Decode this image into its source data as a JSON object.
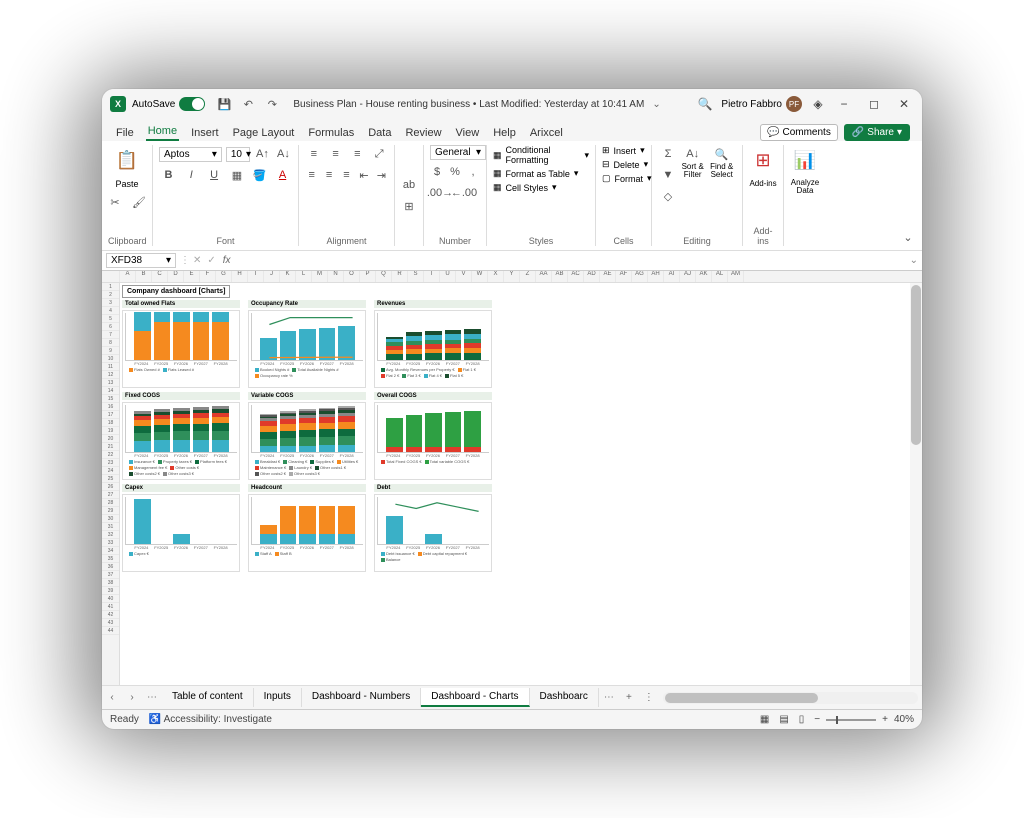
{
  "app": {
    "name": "X",
    "autosave_label": "AutoSave",
    "autosave_on": "On"
  },
  "document": {
    "title": "Business Plan - House renting business • Last Modified: Yesterday at 10:41 AM"
  },
  "user": {
    "name": "Pietro Fabbro",
    "initials": "PF"
  },
  "window_controls": {
    "minimize": "−",
    "restore": "◻",
    "close": "✕"
  },
  "title_actions": {
    "share": "Share",
    "comments": "Comments"
  },
  "menu_tabs": [
    "File",
    "Home",
    "Insert",
    "Page Layout",
    "Formulas",
    "Data",
    "Review",
    "View",
    "Help",
    "Arixcel"
  ],
  "menu_active": "Home",
  "ribbon": {
    "clipboard": {
      "label": "Clipboard",
      "paste": "Paste"
    },
    "font": {
      "label": "Font",
      "name": "Aptos",
      "size": "10"
    },
    "alignment": {
      "label": "Alignment"
    },
    "number": {
      "label": "Number",
      "format": "General"
    },
    "styles": {
      "label": "Styles",
      "cond": "Conditional Formatting",
      "table": "Format as Table",
      "cell": "Cell Styles"
    },
    "cells": {
      "label": "Cells",
      "insert": "Insert",
      "delete": "Delete",
      "format": "Format"
    },
    "editing": {
      "label": "Editing",
      "sort": "Sort & Filter",
      "find": "Find & Select"
    },
    "addins": {
      "label": "Add-ins",
      "btn": "Add-ins"
    },
    "analyze": {
      "label": "",
      "btn": "Analyze Data"
    }
  },
  "name_box": "XFD38",
  "formula": "",
  "dashboard_title": "Company dashboard [Charts]",
  "sheet_tabs": [
    "Table of content",
    "Inputs",
    "Dashboard - Numbers",
    "Dashboard - Charts",
    "Dashboarc"
  ],
  "sheet_active": "Dashboard - Charts",
  "status": {
    "ready": "Ready",
    "access": "Accessibility: Investigate",
    "zoom": "40%"
  },
  "chart_data": [
    {
      "type": "bar",
      "title": "Total owned Flats",
      "categories": [
        "FY2024",
        "FY2025",
        "FY2026",
        "FY2027",
        "FY2028"
      ],
      "series": [
        {
          "name": "Flats Owned #",
          "color": "#f58a1f",
          "values": [
            3,
            4,
            4,
            4,
            4
          ]
        },
        {
          "name": "Flats Leased #",
          "color": "#3ab0c7",
          "values": [
            2,
            1,
            1,
            1,
            1
          ]
        }
      ],
      "ylim": [
        0,
        5
      ],
      "stacked": true
    },
    {
      "type": "bar-line",
      "title": "Occupancy Rate",
      "categories": [
        "FY2024",
        "FY2025",
        "FY2026",
        "FY2027",
        "FY2028"
      ],
      "series": [
        {
          "name": "Booked Nights #",
          "color": "#3ab0c7",
          "values": [
            900,
            1200,
            1300,
            1350,
            1400
          ]
        },
        {
          "name": "Total Available Nights #",
          "color": "#2f8f5b",
          "values": [
            1500,
            1800,
            1800,
            1800,
            1800
          ],
          "kind": "line"
        },
        {
          "name": "Occupancy rate %",
          "color": "#f58a1f",
          "values": [
            60,
            67,
            72,
            75,
            78
          ],
          "kind": "line"
        }
      ],
      "ylim": [
        0,
        2000
      ]
    },
    {
      "type": "bar",
      "title": "Revenues",
      "categories": [
        "FY2024",
        "FY2025",
        "FY2026",
        "FY2027",
        "FY2028"
      ],
      "series": [
        {
          "name": "Avg. Monthly Revenues per Property €",
          "color": "#0e6b3e",
          "values": [
            55000,
            60000,
            63000,
            65000,
            67000
          ]
        },
        {
          "name": "Flat 1 €",
          "color": "#f58a1f",
          "values": [
            40000,
            42000,
            43000,
            44000,
            45000
          ]
        },
        {
          "name": "Flat 2 €",
          "color": "#e03a2a",
          "values": [
            38000,
            40000,
            41000,
            42000,
            43000
          ]
        },
        {
          "name": "Flat 3 €",
          "color": "#2f8f5b",
          "values": [
            35000,
            38000,
            40000,
            41000,
            42000
          ]
        },
        {
          "name": "Flat 4 €",
          "color": "#3ab0c7",
          "values": [
            30000,
            45000,
            47000,
            48000,
            49000
          ]
        },
        {
          "name": "Flat 5 €",
          "color": "#1a4d2e",
          "values": [
            20000,
            40000,
            42000,
            43000,
            44000
          ]
        }
      ],
      "ylim": [
        0,
        450000
      ],
      "stacked": true
    },
    {
      "type": "bar",
      "title": "Fixed COGS",
      "categories": [
        "FY2024",
        "FY2025",
        "FY2026",
        "FY2027",
        "FY2028"
      ],
      "series": [
        {
          "name": "Insurance €",
          "color": "#3ab0c7",
          "values": [
            8000,
            8500,
            8700,
            8800,
            8900
          ]
        },
        {
          "name": "Property taxes €",
          "color": "#2f8f5b",
          "values": [
            6000,
            6200,
            6300,
            6400,
            6500
          ]
        },
        {
          "name": "Platform fees €",
          "color": "#0e6b3e",
          "values": [
            5000,
            5200,
            5400,
            5500,
            5600
          ]
        },
        {
          "name": "Management fee €",
          "color": "#f58a1f",
          "values": [
            4000,
            4100,
            4200,
            4300,
            4350
          ]
        },
        {
          "name": "Other costs €",
          "color": "#e03a2a",
          "values": [
            3000,
            3100,
            3200,
            3300,
            3350
          ]
        },
        {
          "name": "Other costs2 €",
          "color": "#1a4d2e",
          "values": [
            2000,
            2100,
            2200,
            2300,
            2350
          ]
        },
        {
          "name": "Other costs3 €",
          "color": "#888",
          "values": [
            2000,
            2100,
            2200,
            2300,
            2350
          ]
        }
      ],
      "ylim": [
        0,
        35000
      ],
      "stacked": true
    },
    {
      "type": "bar",
      "title": "Variable COGS",
      "categories": [
        "FY2024",
        "FY2025",
        "FY2026",
        "FY2027",
        "FY2028"
      ],
      "series": [
        {
          "name": "Breakfast €",
          "color": "#3ab0c7",
          "values": [
            30000,
            32000,
            33000,
            34000,
            35000
          ]
        },
        {
          "name": "Cleaning €",
          "color": "#2f8f5b",
          "values": [
            40000,
            42000,
            44000,
            45000,
            46000
          ]
        },
        {
          "name": "Supplies €",
          "color": "#0e6b3e",
          "values": [
            35000,
            38000,
            39000,
            40000,
            41000
          ]
        },
        {
          "name": "Utilities €",
          "color": "#f58a1f",
          "values": [
            30000,
            32000,
            33000,
            34000,
            35000
          ]
        },
        {
          "name": "Maintenance €",
          "color": "#e03a2a",
          "values": [
            25000,
            26000,
            27000,
            28000,
            29000
          ]
        },
        {
          "name": "Laundry €",
          "color": "#888",
          "values": [
            15000,
            16000,
            17000,
            18000,
            19000
          ]
        },
        {
          "name": "Other costs1 €",
          "color": "#1a4d2e",
          "values": [
            10000,
            11000,
            12000,
            13000,
            14000
          ]
        },
        {
          "name": "Other costs2 €",
          "color": "#555",
          "values": [
            8000,
            9000,
            10000,
            11000,
            12000
          ]
        },
        {
          "name": "Other costs3 €",
          "color": "#aaa",
          "values": [
            5000,
            6000,
            7000,
            8000,
            9000
          ]
        }
      ],
      "ylim": [
        0,
        250000
      ],
      "stacked": true
    },
    {
      "type": "bar",
      "title": "Overall COGS",
      "categories": [
        "FY2024",
        "FY2025",
        "FY2026",
        "FY2027",
        "FY2028"
      ],
      "series": [
        {
          "name": "Total Fixed COGS €",
          "color": "#e03a2a",
          "values": [
            30000,
            31000,
            32000,
            33000,
            34000
          ]
        },
        {
          "name": "Total variable COGS €",
          "color": "#2ea043",
          "values": [
            180000,
            200000,
            210000,
            220000,
            225000
          ]
        }
      ],
      "ylim": [
        0,
        300000
      ],
      "stacked": true
    },
    {
      "type": "bar",
      "title": "Capex",
      "categories": [
        "FY2024",
        "FY2025",
        "FY2026",
        "FY2027",
        "FY2028"
      ],
      "series": [
        {
          "name": "Capex €",
          "color": "#3ab0c7",
          "values": [
            280000,
            0,
            60000,
            0,
            0
          ]
        }
      ],
      "ylim": [
        0,
        300000
      ]
    },
    {
      "type": "bar",
      "title": "Headcount",
      "categories": [
        "FY2024",
        "FY2025",
        "FY2026",
        "FY2027",
        "FY2028"
      ],
      "series": [
        {
          "name": "Staff A",
          "color": "#3ab0c7",
          "values": [
            1,
            1,
            1,
            1,
            1
          ]
        },
        {
          "name": "Staff B",
          "color": "#f58a1f",
          "values": [
            1,
            3,
            3,
            3,
            3
          ]
        }
      ],
      "ylim": [
        0,
        5
      ],
      "stacked": true
    },
    {
      "type": "bar-line",
      "title": "Debt",
      "categories": [
        "FY2024",
        "FY2025",
        "FY2026",
        "FY2027",
        "FY2028"
      ],
      "series": [
        {
          "name": "Debt issuance €",
          "color": "#3ab0c7",
          "values": [
            95000,
            0,
            35000,
            0,
            0
          ]
        },
        {
          "name": "Debt capital repayment €",
          "color": "#f58a1f",
          "values": [
            -15000,
            -15000,
            -15000,
            -15000,
            -15000
          ]
        },
        {
          "name": "Balance",
          "color": "#2f8f5b",
          "values": [
            95000,
            80000,
            100000,
            85000,
            70000
          ],
          "kind": "line"
        }
      ],
      "ylim": [
        -40000,
        120000
      ]
    }
  ]
}
